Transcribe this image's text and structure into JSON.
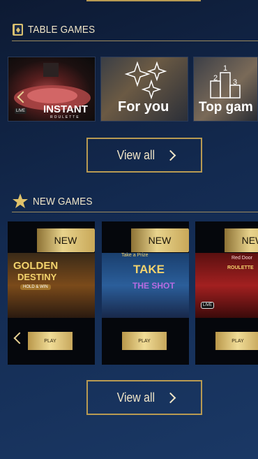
{
  "table_games": {
    "title": "TABLE GAMES",
    "tiles": [
      {
        "title": "INSTANT",
        "subtitle": "ROULETTE",
        "badge": "LIVE"
      },
      {
        "title": "For you"
      },
      {
        "title": "Top gam"
      }
    ],
    "view_all": "View all"
  },
  "new_games": {
    "title": "NEW GAMES",
    "cards": [
      {
        "badge": "NEW",
        "game_title": "GOLDEN",
        "game_title2": "DESTINY",
        "game_sub": "HOLD & WIN",
        "play": "PLAY"
      },
      {
        "badge": "NEW",
        "game_top": "Take a Prize",
        "game_title": "TAKE",
        "game_title2": "THE SHOT",
        "play": "PLAY"
      },
      {
        "badge": "NEW",
        "live": "LIVE",
        "game_title": "Red Door",
        "game_title2": "ROULETTE",
        "play": "PLAY"
      }
    ],
    "view_all": "View all"
  },
  "colors": {
    "gold": "#b89a52",
    "gold_light": "#f0dc97",
    "background": "#132a50"
  }
}
